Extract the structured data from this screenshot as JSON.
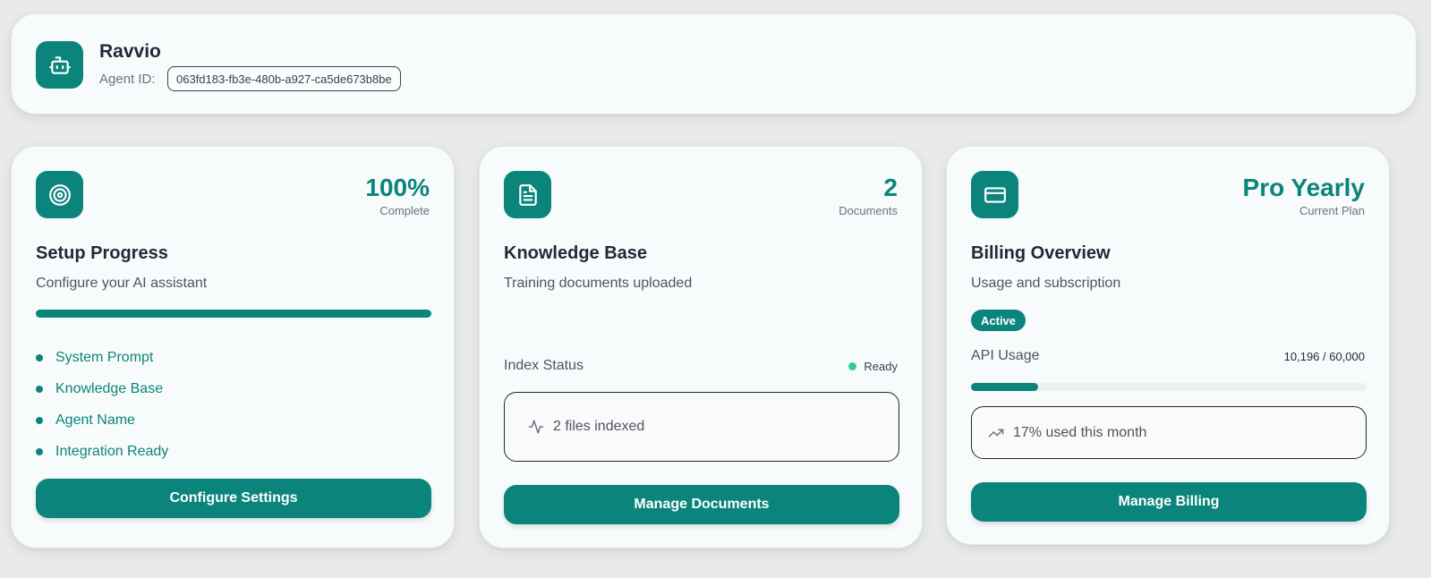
{
  "header": {
    "agent_name": "Ravvio",
    "agent_id_label": "Agent ID:",
    "agent_id": "063fd183-fb3e-480b-a927-ca5de673b8be",
    "icon": "bot-icon"
  },
  "setup": {
    "icon": "target-icon",
    "stat": "100%",
    "stat_label": "Complete",
    "progress": 1.0,
    "title": "Setup Progress",
    "subtitle": "Configure your AI assistant",
    "items": [
      "System Prompt",
      "Knowledge Base",
      "Agent Name",
      "Integration Ready"
    ],
    "button": "Configure Settings"
  },
  "knowledge": {
    "icon": "document-icon",
    "stat": "2",
    "stat_label": "Documents",
    "title": "Knowledge Base",
    "subtitle": "Training documents uploaded",
    "index_label": "Index Status",
    "index_status": "Ready",
    "indexed_text": "2 files indexed",
    "button": "Manage Documents"
  },
  "billing": {
    "icon": "credit-card-icon",
    "stat": "Pro Yearly",
    "stat_label": "Current Plan",
    "title": "Billing Overview",
    "subtitle": "Usage and subscription",
    "badge": "Active",
    "usage_label": "API Usage",
    "usage_value": "10,196 / 60,000",
    "usage_fraction": 0.17,
    "usage_text": "17% used this month",
    "button": "Manage Billing"
  },
  "colors": {
    "accent": "#0b857b",
    "ready": "#34c99a"
  }
}
